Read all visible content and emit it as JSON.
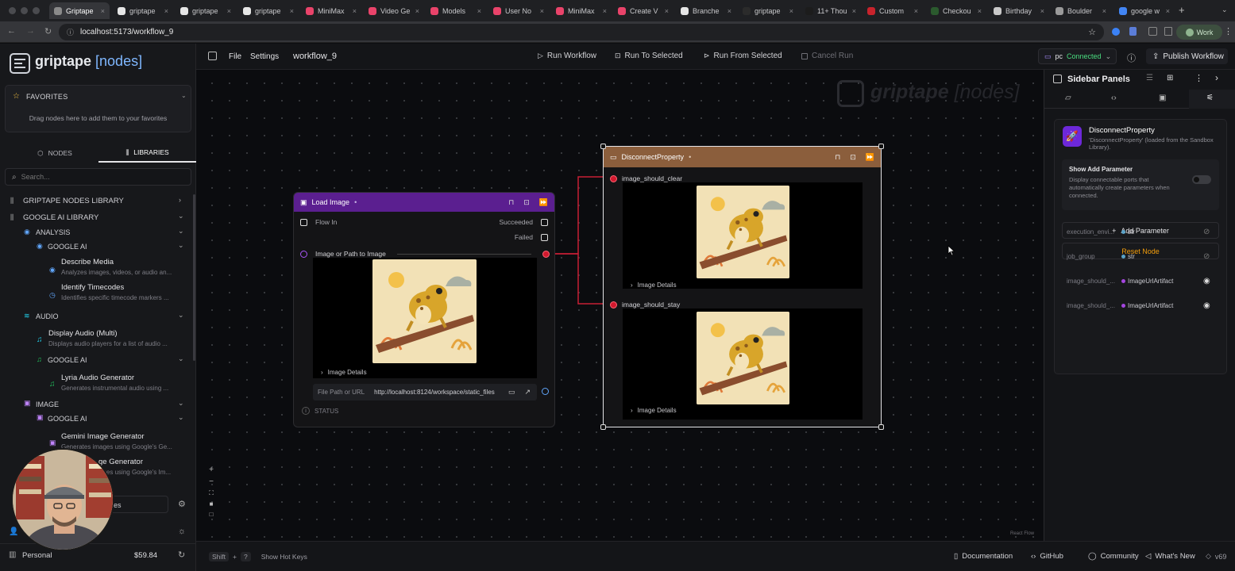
{
  "browser": {
    "tabs": [
      {
        "label": "Griptape",
        "color": "#8a8a8a",
        "active": true
      },
      {
        "label": "griptape",
        "color": "#e6e6e6",
        "active": false
      },
      {
        "label": "griptape",
        "color": "#e6e6e6",
        "active": false
      },
      {
        "label": "griptape",
        "color": "#e6e6e6",
        "active": false
      },
      {
        "label": "MiniMax",
        "color": "#e9436a",
        "active": false
      },
      {
        "label": "Video Ge",
        "color": "#e9436a",
        "active": false
      },
      {
        "label": "Models",
        "color": "#e9436a",
        "active": false
      },
      {
        "label": "User No",
        "color": "#e9436a",
        "active": false
      },
      {
        "label": "MiniMax",
        "color": "#e9436a",
        "active": false
      },
      {
        "label": "Create V",
        "color": "#e9436a",
        "active": false
      },
      {
        "label": "Branche",
        "color": "#e6e6e6",
        "active": false
      },
      {
        "label": "griptape",
        "color": "#2b2b2b",
        "active": false
      },
      {
        "label": "11+ Thou",
        "color": "#1c1c1c",
        "active": false
      },
      {
        "label": "Custom",
        "color": "#c8232c",
        "active": false
      },
      {
        "label": "Checkou",
        "color": "#2b5a2e",
        "active": false
      },
      {
        "label": "Birthday",
        "color": "#c9c9c9",
        "active": false
      },
      {
        "label": "Boulder",
        "color": "#9a9a9a",
        "active": false
      },
      {
        "label": "google w",
        "color": "#4285f4",
        "active": false
      }
    ],
    "url": "localhost:5173/workflow_9",
    "profile": "Work"
  },
  "app": {
    "logo_text": "griptape",
    "logo_accent": "[nodes]",
    "menu": {
      "file": "File",
      "settings": "Settings"
    },
    "workflow_name": "workflow_9",
    "toolbar": {
      "run_workflow": "Run Workflow",
      "run_to_selected": "Run To Selected",
      "run_from_selected": "Run From Selected",
      "cancel_run": "Cancel Run"
    },
    "connection": {
      "engine": "pc",
      "status": "Connected"
    },
    "publish": "Publish Workflow"
  },
  "left_panel": {
    "favorites": {
      "title": "FAVORITES",
      "hint": "Drag nodes here to add them to your favorites"
    },
    "tabs": {
      "nodes": "NODES",
      "libraries": "LIBRARIES"
    },
    "search_placeholder": "Search...",
    "libraries": {
      "griptape_nodes": "GRIPTAPE NODES LIBRARY",
      "google_ai": "GOOGLE AI LIBRARY",
      "analysis": "ANALYSIS",
      "analysis_google": "GOOGLE AI",
      "describe_media": {
        "title": "Describe Media",
        "desc": "Analyzes images, videos, or audio an..."
      },
      "identify_timecodes": {
        "title": "Identify Timecodes",
        "desc": "Identifies specific timecode markers ..."
      },
      "audio": "AUDIO",
      "display_audio": {
        "title": "Display Audio (Multi)",
        "desc": "Displays audio players for a list of audio ..."
      },
      "audio_google": "GOOGLE AI",
      "lyria": {
        "title": "Lyria Audio Generator",
        "desc": "Generates instrumental audio using ..."
      },
      "image": "IMAGE",
      "image_google": "GOOGLE AI",
      "gemini": {
        "title": "Gemini Image Generator",
        "desc": "Generates images using Google's Ge..."
      },
      "imagen": {
        "title": "ge Generator",
        "desc": "Generates images using Google's Im..."
      }
    },
    "footer": {
      "workspace_partial": "les",
      "account": "Personal",
      "credits": "$59.84"
    }
  },
  "canvas": {
    "watermark_a": "griptape",
    "watermark_b": "[nodes]",
    "load_image": {
      "title": "Load Image",
      "suffix": "•",
      "flow_in": "Flow In",
      "succeeded": "Succeeded",
      "failed": "Failed",
      "param": "Image or Path to Image",
      "details": "Image Details",
      "file_label": "File Path or URL",
      "file_value": "http://localhost:8124/workspace/static_files",
      "status": "STATUS"
    },
    "disconnect": {
      "title": "DisconnectProperty",
      "suffix": "•",
      "p1": "image_should_clear",
      "p2": "image_should_stay",
      "details1": "Image Details",
      "details2": "Image Details"
    },
    "react_flow": "React Flow"
  },
  "right_panel": {
    "title": "Sidebar Panels",
    "node_title": "DisconnectProperty",
    "node_desc": "'DisconnectProperty' (loaded from the Sandbox Library).",
    "show_add": {
      "title": "Show Add Parameter",
      "desc": "Display connectable ports that automatically create parameters when connected.",
      "enabled": false
    },
    "add_parameter": "Add Parameter",
    "reset_node": "Reset Node",
    "params": [
      {
        "name": "execution_envi...",
        "type": "str",
        "dot": "#5aa2c7",
        "visible": false
      },
      {
        "name": "job_group",
        "type": "str",
        "dot": "#5aa2c7",
        "visible": false
      },
      {
        "name": "image_should_...",
        "type": "ImageUrlArtifact",
        "dot": "#a545e0",
        "visible": true
      },
      {
        "name": "image_should_...",
        "type": "ImageUrlArtifact",
        "dot": "#a545e0",
        "visible": true
      }
    ]
  },
  "bottom_bar": {
    "key_shift": "Shift",
    "key_plus": "+",
    "key_q": "?",
    "hot_keys": "Show Hot Keys",
    "documentation": "Documentation",
    "github": "GitHub",
    "community": "Community",
    "whats_new": "What's New",
    "version": "v69"
  },
  "colors": {
    "accent": "#60a5fa",
    "connected": "#4ade80",
    "node_purple": "#6b21a8",
    "node_brown": "#8b5e3c",
    "wire": "#c81e35",
    "reset": "#f59e0b"
  }
}
